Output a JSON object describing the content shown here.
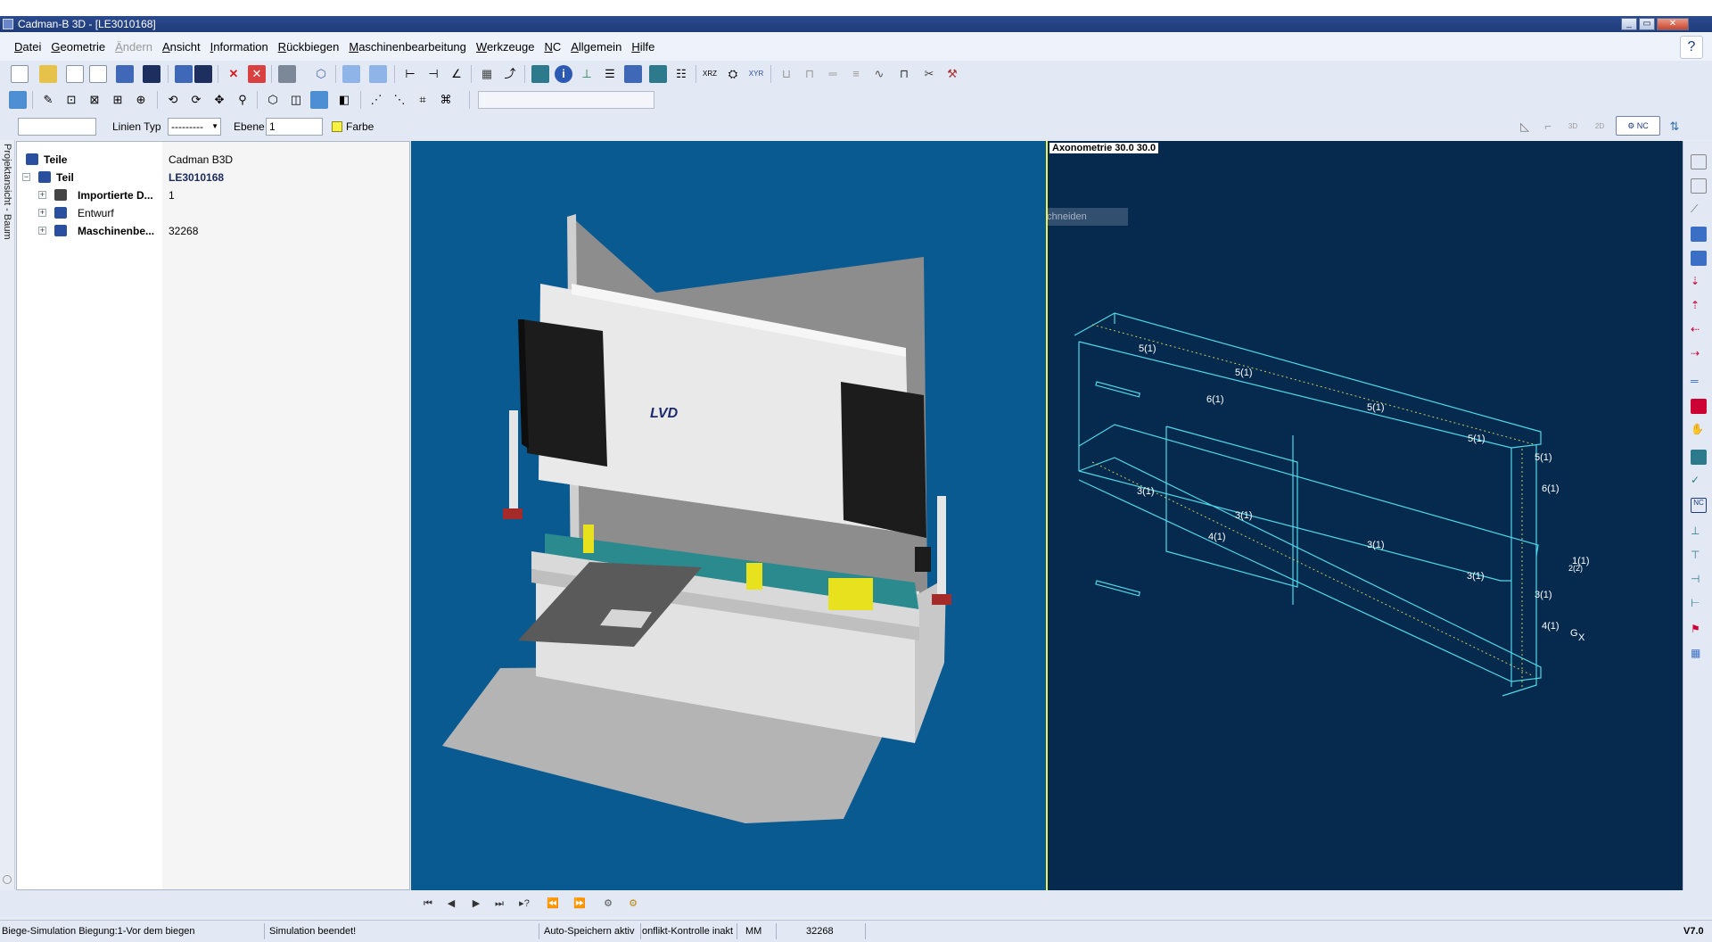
{
  "window": {
    "title": "Cadman-B 3D - [LE3010168]",
    "controls": [
      "minimize",
      "restore",
      "close"
    ]
  },
  "menu": {
    "items": [
      {
        "label": "Datei",
        "enabled": true
      },
      {
        "label": "Geometrie",
        "enabled": true
      },
      {
        "label": "Ändern",
        "enabled": false
      },
      {
        "label": "Ansicht",
        "enabled": true
      },
      {
        "label": "Information",
        "enabled": true
      },
      {
        "label": "Rückbiegen",
        "enabled": true
      },
      {
        "label": "Maschinenbearbeitung",
        "enabled": true
      },
      {
        "label": "Werkzeuge",
        "enabled": true
      },
      {
        "label": "NC",
        "enabled": true
      },
      {
        "label": "Allgemein",
        "enabled": true
      },
      {
        "label": "Hilfe",
        "enabled": true
      }
    ]
  },
  "properties_bar": {
    "text_value": "",
    "line_type_label": "Linien Typ",
    "line_type_value": "---------",
    "level_label": "Ebene",
    "level_value": "1",
    "color_label": "Farbe",
    "color_value": "#f7f142"
  },
  "side_tab": {
    "label": "Projektansicht - Baum"
  },
  "tree": {
    "rows": [
      {
        "label": "Teile",
        "value": "Cadman B3D",
        "bold": true,
        "level": 0
      },
      {
        "label": "Teil",
        "value": "LE3010168",
        "bold": true,
        "level": 1
      },
      {
        "label": "Importierte D...",
        "value": "1",
        "bold": true,
        "level": 2
      },
      {
        "label": "Entwurf",
        "value": "",
        "bold": false,
        "level": 2
      },
      {
        "label": "Maschinenbe...",
        "value": "32268",
        "bold": true,
        "level": 2
      }
    ]
  },
  "viewport_3d": {
    "machine_logo": "LVD",
    "hint": "Rechteckiges Ausschneiden"
  },
  "viewport_axo": {
    "label": "Axonometrie 30.0 30.0",
    "bend_labels": [
      "5(1)",
      "5(1)",
      "6(1)",
      "5(1)",
      "5(1)",
      "5(1)",
      "6(1)",
      "3(1)",
      "3(1)",
      "4(1)",
      "3(1)",
      "3(1)",
      "3(1)",
      "4(1)",
      "1(1)",
      "2(2)"
    ],
    "axis_labels": [
      "G",
      "X"
    ]
  },
  "status": {
    "simulation_step": "Biege-Simulation Biegung:1-Vor dem biegen",
    "simulation_state": "Simulation beendet!",
    "autosave": "Auto-Speichern aktiv",
    "conflict": "onflikt-Kontrolle inakt",
    "units": "MM",
    "machine_no": "32268",
    "version": "V7.0"
  }
}
